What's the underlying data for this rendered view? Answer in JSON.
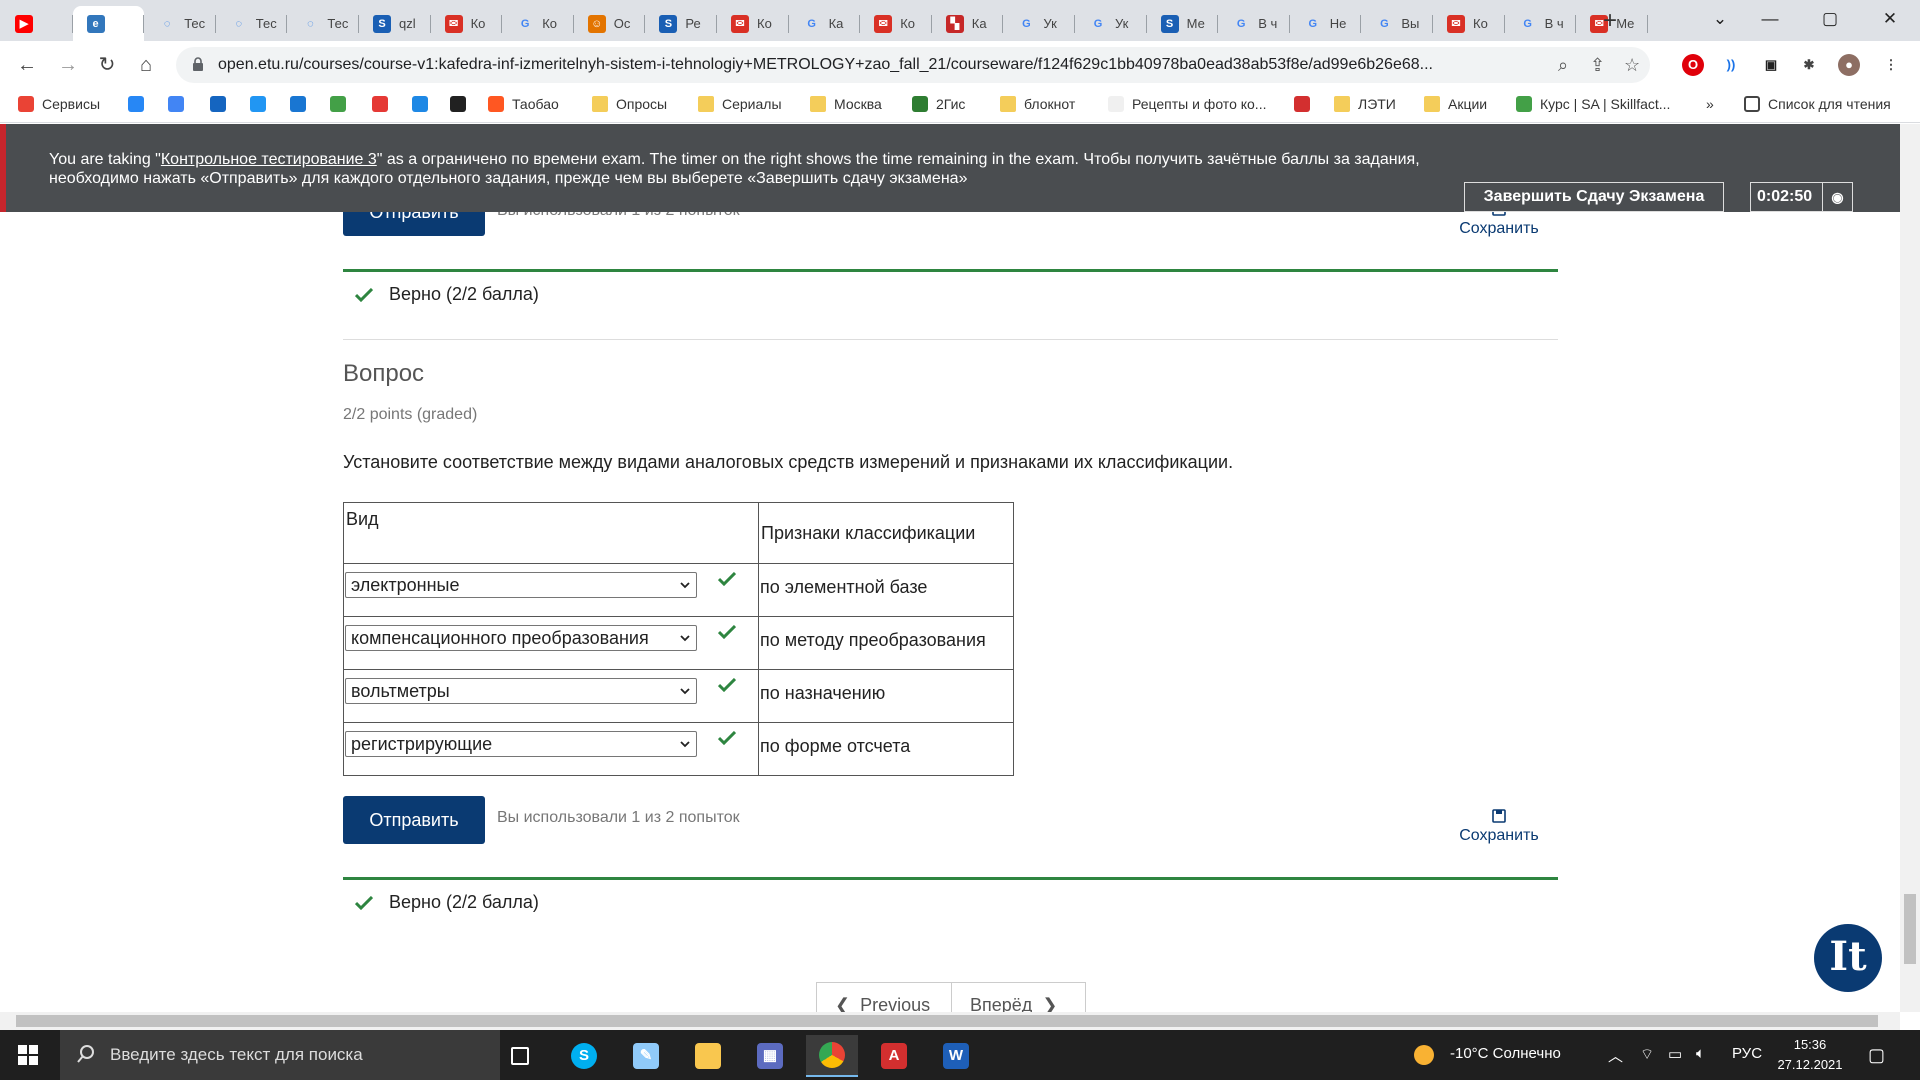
{
  "browser": {
    "tabs": [
      {
        "label": "",
        "icon": "youtube-icon",
        "color": "#ff0000"
      },
      {
        "label": "",
        "icon": "edge-icon",
        "color": "#3277bc",
        "active": true
      },
      {
        "label": "Тес",
        "icon": "loading-icon",
        "color": "#1a73e8"
      },
      {
        "label": "Тес",
        "icon": "loading-icon",
        "color": "#1a73e8"
      },
      {
        "label": "Тес",
        "icon": "loading-icon",
        "color": "#1a73e8"
      },
      {
        "label": "qzl",
        "icon": "s-icon",
        "color": "#1a5fb4"
      },
      {
        "label": "Ко",
        "icon": "mail-icon",
        "color": "#d93025"
      },
      {
        "label": "Ко",
        "icon": "google-icon",
        "color": "#4285f4"
      },
      {
        "label": "Ос",
        "icon": "people-icon",
        "color": "#e37400"
      },
      {
        "label": "Ре",
        "icon": "s-icon",
        "color": "#1a5fb4"
      },
      {
        "label": "Ко",
        "icon": "mail-icon",
        "color": "#d93025"
      },
      {
        "label": "Ка",
        "icon": "google-icon",
        "color": "#4285f4"
      },
      {
        "label": "Ко",
        "icon": "mail-icon",
        "color": "#d93025"
      },
      {
        "label": "Ка",
        "icon": "flag-icon",
        "color": "#c62828"
      },
      {
        "label": "Ук",
        "icon": "google-icon",
        "color": "#4285f4"
      },
      {
        "label": "Ук",
        "icon": "google-icon",
        "color": "#4285f4"
      },
      {
        "label": "Ме",
        "icon": "s-icon",
        "color": "#1a5fb4"
      },
      {
        "label": "В ч",
        "icon": "google-icon",
        "color": "#4285f4"
      },
      {
        "label": "Не",
        "icon": "google-icon",
        "color": "#4285f4"
      },
      {
        "label": "Вы",
        "icon": "google-icon",
        "color": "#4285f4"
      },
      {
        "label": "Ко",
        "icon": "mail-icon",
        "color": "#d93025"
      },
      {
        "label": "В ч",
        "icon": "google-icon",
        "color": "#4285f4"
      },
      {
        "label": "Ме",
        "icon": "mail-icon",
        "color": "#d93025"
      }
    ],
    "new_tab": "+",
    "url": "open.etu.ru/courses/course-v1:kafedra-inf-izmeritelnyh-sistem-i-tehnologiy+METROLOGY+zao_fall_21/courseware/f124f629c1bb40978ba0ead38ab53f8e/ad99e6b26e68..."
  },
  "bookmarks": [
    {
      "label": "Сервисы",
      "icon": "apps-grid-icon",
      "color": "#ea4335"
    },
    {
      "label": "",
      "icon": "vk-icon",
      "color": "#2787f5"
    },
    {
      "label": "",
      "icon": "translate-icon",
      "color": "#4285f4"
    },
    {
      "label": "",
      "icon": "mail-icon",
      "color": "#1565c0"
    },
    {
      "label": "",
      "icon": "camera-icon",
      "color": "#2196f3"
    },
    {
      "label": "",
      "icon": "at-icon",
      "color": "#1976d2"
    },
    {
      "label": "",
      "icon": "check-circle-icon",
      "color": "#43a047"
    },
    {
      "label": "",
      "icon": "bag-icon",
      "color": "#e53935"
    },
    {
      "label": "",
      "icon": "drop-icon",
      "color": "#1e88e5"
    },
    {
      "label": "",
      "icon": "d-icon",
      "color": "#212121"
    },
    {
      "label": "Таобао",
      "icon": "taobao-icon",
      "color": "#ff5722"
    },
    {
      "label": "Опросы",
      "icon": "folder-icon",
      "color": "#f4cd5a"
    },
    {
      "label": "Сериалы",
      "icon": "folder-icon",
      "color": "#f4cd5a"
    },
    {
      "label": "Москва",
      "icon": "folder-icon",
      "color": "#f4cd5a"
    },
    {
      "label": "2Гис",
      "icon": "2gis-icon",
      "color": "#2e7d32"
    },
    {
      "label": "блокнот",
      "icon": "folder-icon",
      "color": "#f4cd5a"
    },
    {
      "label": "Рецепты и фото ко...",
      "icon": "recipe-icon",
      "color": "#f0f0f0"
    },
    {
      "label": "",
      "icon": "hh-icon",
      "color": "#d32f2f"
    },
    {
      "label": "ЛЭТИ",
      "icon": "folder-icon",
      "color": "#f4cd5a"
    },
    {
      "label": "Акции",
      "icon": "folder-icon",
      "color": "#f4cd5a"
    },
    {
      "label": "Курс | SA | Skillfact...",
      "icon": "skillfactory-icon",
      "color": "#43a047"
    }
  ],
  "bookmarks_more": "»",
  "reading_list": "Список для чтения",
  "banner": {
    "prefix": "You are taking \"",
    "exam_link": "Контрольное тестирование 3",
    "suffix": "\" as a ограничено по времени exam. The timer on the right shows the time remaining in the exam. Чтобы получить зачётные баллы за задания, необходимо нажать «Отправить» для каждого отдельного задания, прежде чем вы выберете «Завершить сдачу экзамена»",
    "finish_label": "Завершить Сдачу Экзамена",
    "timer": "0:02:50",
    "accent": "#c6252c"
  },
  "prev_problem": {
    "submit_label": "Отправить",
    "attempts": "Вы использовали 1 из 2 попыток",
    "save_label": "Сохранить",
    "result": "Верно (2/2 балла)"
  },
  "question": {
    "title": "Вопрос",
    "points": "2/2 points (graded)",
    "text": "Установите соответствие между видами аналоговых средств измерений и признаками их классификации.",
    "col_a_header": "Вид",
    "col_b_header": "Признаки классификации",
    "rows": [
      {
        "selected": "электронные",
        "criterion": "по элементной базе",
        "correct": true
      },
      {
        "selected": "компенсационного преобразования",
        "criterion": "по методу преобразования",
        "correct": true
      },
      {
        "selected": "вольтметры",
        "criterion": "по назначению",
        "correct": true
      },
      {
        "selected": "регистрирующие",
        "criterion": "по форме отсчета",
        "correct": true
      }
    ],
    "submit_label": "Отправить",
    "attempts": "Вы использовали 1 из 2 попыток",
    "save_label": "Сохранить",
    "result": "Верно (2/2 балла)",
    "correct_color": "#2e8540"
  },
  "nav": {
    "prev_label": "Previous",
    "next_label": "Вперёд"
  },
  "badge": "It",
  "taskbar": {
    "search_placeholder": "Введите здесь текст для поиска",
    "apps": [
      "task-view-icon",
      "skype-icon",
      "paint-icon",
      "explorer-icon",
      "calculator-icon",
      "chrome-icon",
      "acrobat-icon",
      "word-icon"
    ],
    "weather": "-10°C  Солнечно",
    "lang": "РУС",
    "time": "15:36",
    "date": "27.12.2021"
  }
}
